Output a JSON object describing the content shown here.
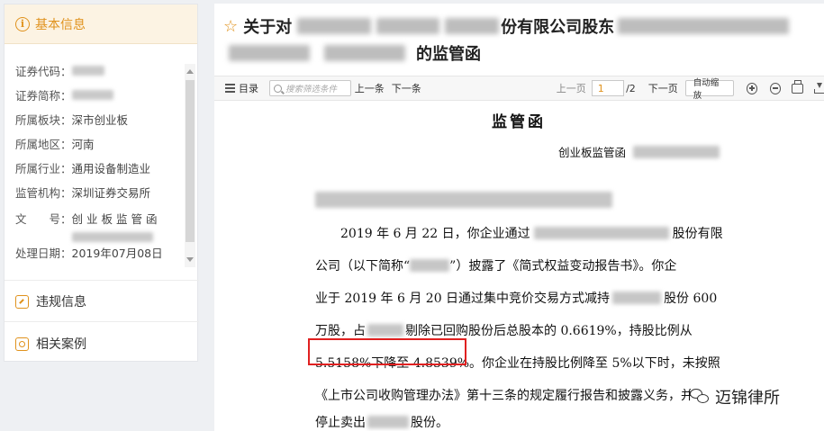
{
  "sidebar": {
    "header": "基本信息",
    "fields": [
      {
        "label": "证券代码：",
        "value": ""
      },
      {
        "label": "证券简称：",
        "value": ""
      },
      {
        "label": "所属板块：",
        "value": "深市创业板"
      },
      {
        "label": "所属地区：",
        "value": "河南"
      },
      {
        "label": "所属行业：",
        "value": "通用设备制造业"
      },
      {
        "label": "监管机构：",
        "value": "深圳证券交易所"
      },
      {
        "label": "文　　号：",
        "value": "创业板监管函"
      },
      {
        "label": "处理日期：",
        "value": "2019年07月08日"
      }
    ],
    "links": [
      {
        "label": "违规信息"
      },
      {
        "label": "相关案例"
      }
    ]
  },
  "main": {
    "title_part1": "关于对",
    "title_part2": "份有限公司股东",
    "title_part3": "的监管函",
    "toolbar": {
      "toc_label": "目录",
      "search_placeholder": "搜索筛选条件",
      "prev_result": "上一条",
      "next_result": "下一条",
      "prev_page": "上一页",
      "current_page": "1",
      "total_pages": "/2",
      "next_page": "下一页",
      "zoom_label": "自动缩放"
    }
  },
  "document": {
    "title": "监管函",
    "dept": "创业板监管函",
    "lines": {
      "l1a": "2019 年 6 月 22 日，你企业通过",
      "l1b": "股份有限",
      "l2a": "公司（以下简称“",
      "l2b": "”）披露了《简式权益变动报告书》。你企",
      "l3a": "业于 2019 年 6 月 20 日通过集中竞价交易方式减持",
      "l3b": "股份 600",
      "l4a": "万股，占",
      "l4b": "剔除已回购股份后总股本的 0.6619%，持股比例从",
      "l5a": "5.5158%下降至 4.8539%",
      "l5b": "。你企业在持股比例降至 5%以下时，未按照",
      "l6": "《上市公司收购管理办法》第十三条的规定履行报告和披露义务，并",
      "l7a": "停止卖出",
      "l7b": "股份。"
    }
  },
  "watermark": {
    "text": "迈锦律所"
  },
  "colors": {
    "accent": "#e0921d",
    "highlight_box": "#e02020"
  }
}
